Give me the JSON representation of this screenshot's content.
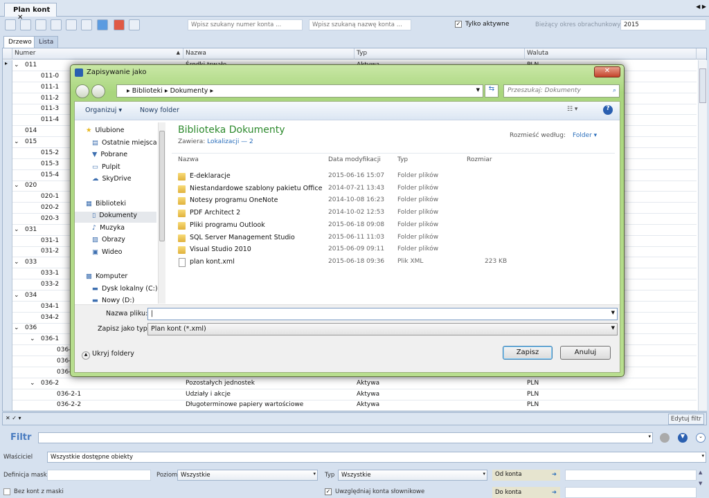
{
  "tab": {
    "title": "Plan kont",
    "close": "✕"
  },
  "toolbar": {
    "search_number_placeholder": "Wpisz szukany numer konta ...",
    "search_name_placeholder": "Wpisz szukaną nazwę konta ...",
    "only_active_label": "Tylko aktywne",
    "only_active_checked": true,
    "period_label": "Bieżący okres obrachunkowy:",
    "period_value": "2015"
  },
  "view_tabs": [
    "Drzewo",
    "Lista"
  ],
  "grid": {
    "columns": [
      "Numer",
      "Nazwa",
      "Typ",
      "Waluta"
    ],
    "rows": [
      {
        "num": "011",
        "lvl": 0,
        "exp": true,
        "name": "Środki trwałe",
        "typ": "Aktywa",
        "wal": "PLN"
      },
      {
        "num": "011-0",
        "lvl": 1
      },
      {
        "num": "011-1",
        "lvl": 1
      },
      {
        "num": "011-2",
        "lvl": 1
      },
      {
        "num": "011-3",
        "lvl": 1
      },
      {
        "num": "011-4",
        "lvl": 1
      },
      {
        "num": "014",
        "lvl": 0
      },
      {
        "num": "015",
        "lvl": 0,
        "exp": true
      },
      {
        "num": "015-2",
        "lvl": 1
      },
      {
        "num": "015-3",
        "lvl": 1
      },
      {
        "num": "015-4",
        "lvl": 1
      },
      {
        "num": "020",
        "lvl": 0,
        "exp": true
      },
      {
        "num": "020-1",
        "lvl": 1
      },
      {
        "num": "020-2",
        "lvl": 1
      },
      {
        "num": "020-3",
        "lvl": 1
      },
      {
        "num": "031",
        "lvl": 0,
        "exp": true
      },
      {
        "num": "031-1",
        "lvl": 1
      },
      {
        "num": "031-2",
        "lvl": 1
      },
      {
        "num": "033",
        "lvl": 0,
        "exp": true
      },
      {
        "num": "033-1",
        "lvl": 1
      },
      {
        "num": "033-2",
        "lvl": 1
      },
      {
        "num": "034",
        "lvl": 0,
        "exp": true
      },
      {
        "num": "034-1",
        "lvl": 1
      },
      {
        "num": "034-2",
        "lvl": 1
      },
      {
        "num": "036",
        "lvl": 0,
        "exp": true
      },
      {
        "num": "036-1",
        "lvl": 1,
        "exp": true
      },
      {
        "num": "036-1-1",
        "lvl": 2
      },
      {
        "num": "036-1-2",
        "lvl": 2
      },
      {
        "num": "036-1-3",
        "lvl": 2
      },
      {
        "num": "036-2",
        "lvl": 1,
        "exp": true,
        "name": "Pozostałych jednostek",
        "typ": "Aktywa",
        "wal": "PLN"
      },
      {
        "num": "036-2-1",
        "lvl": 2,
        "name": "Udziały i akcje",
        "typ": "Aktywa",
        "wal": "PLN"
      },
      {
        "num": "036-2-2",
        "lvl": 2,
        "name": "Długoterminowe papiery wartościowe",
        "typ": "Aktywa",
        "wal": "PLN"
      }
    ],
    "edit_filter": "Edytuj filtr"
  },
  "dialog": {
    "title": "Zapisywanie jako",
    "breadcrumb": [
      "Biblioteki",
      "Dokumenty"
    ],
    "search_placeholder": "Przeszukaj: Dokumenty",
    "organize": "Organizuj ▾",
    "new_folder": "Nowy folder",
    "nav": [
      {
        "label": "Ulubione",
        "icon": "star-icon",
        "head": true
      },
      {
        "label": "Ostatnie miejsca",
        "icon": "recent-icon"
      },
      {
        "label": "Pobrane",
        "icon": "downloads-icon"
      },
      {
        "label": "Pulpit",
        "icon": "desktop-icon"
      },
      {
        "label": "SkyDrive",
        "icon": "cloud-icon"
      },
      {
        "label": "Biblioteki",
        "icon": "library-icon",
        "head": true,
        "gap": true
      },
      {
        "label": "Dokumenty",
        "icon": "document-icon",
        "selected": true
      },
      {
        "label": "Muzyka",
        "icon": "music-icon"
      },
      {
        "label": "Obrazy",
        "icon": "pictures-icon"
      },
      {
        "label": "Wideo",
        "icon": "video-icon"
      },
      {
        "label": "Komputer",
        "icon": "computer-icon",
        "head": true,
        "gap": true
      },
      {
        "label": "Dysk lokalny (C:)",
        "icon": "drive-icon"
      },
      {
        "label": "Nowy (D:)",
        "icon": "drive-icon"
      }
    ],
    "library_title": "Biblioteka Dokumenty",
    "contains_label": "Zawiera:",
    "contains_link": "Lokalizacji — 2",
    "arrange_label": "Rozmieść według:",
    "arrange_value": "Folder ▾",
    "columns": [
      "Nazwa",
      "Data modyfikacji",
      "Typ",
      "Rozmiar"
    ],
    "files": [
      {
        "name": "E-deklaracje",
        "date": "2015-06-16 15:07",
        "type": "Folder plików",
        "size": "",
        "folder": true
      },
      {
        "name": "Niestandardowe szablony pakietu Office",
        "date": "2014-07-21 13:43",
        "type": "Folder plików",
        "size": "",
        "folder": true
      },
      {
        "name": "Notesy programu OneNote",
        "date": "2014-10-08 16:23",
        "type": "Folder plików",
        "size": "",
        "folder": true
      },
      {
        "name": "PDF Architect 2",
        "date": "2014-10-02 12:53",
        "type": "Folder plików",
        "size": "",
        "folder": true
      },
      {
        "name": "Pliki programu Outlook",
        "date": "2015-06-18 09:08",
        "type": "Folder plików",
        "size": "",
        "folder": true
      },
      {
        "name": "SQL Server Management Studio",
        "date": "2015-06-11 11:03",
        "type": "Folder plików",
        "size": "",
        "folder": true
      },
      {
        "name": "Visual Studio 2010",
        "date": "2015-06-09 09:11",
        "type": "Folder plików",
        "size": "",
        "folder": true
      },
      {
        "name": "plan kont.xml",
        "date": "2015-06-18 09:36",
        "type": "Plik XML",
        "size": "223 KB",
        "folder": false
      }
    ],
    "filename_label": "Nazwa pliku:",
    "filename_value": "",
    "filetype_label": "Zapisz jako typ:",
    "filetype_value": "Plan kont (*.xml)",
    "hide_folders": "Ukryj foldery",
    "save": "Zapisz",
    "cancel": "Anuluj"
  },
  "filter": {
    "title": "Filtr",
    "value": "",
    "owner_label": "Właściciel",
    "owner_value": "Wszystkie dostępne obiekty",
    "mask_label": "Definicja maski",
    "level_label": "Poziom",
    "level_value": "Wszystkie",
    "type_label": "Typ",
    "type_value": "Wszystkie",
    "from_label": "Od konta",
    "to_label": "Do konta",
    "no_mask_label": "Bez kont z maski",
    "no_mask_checked": false,
    "include_dict_label": "Uwzględniaj konta słownikowe",
    "include_dict_checked": true
  },
  "colors": {
    "accent": "#2a6ebb",
    "dialog_frame": "#a9d67d",
    "library_title": "#2d8a2d"
  }
}
